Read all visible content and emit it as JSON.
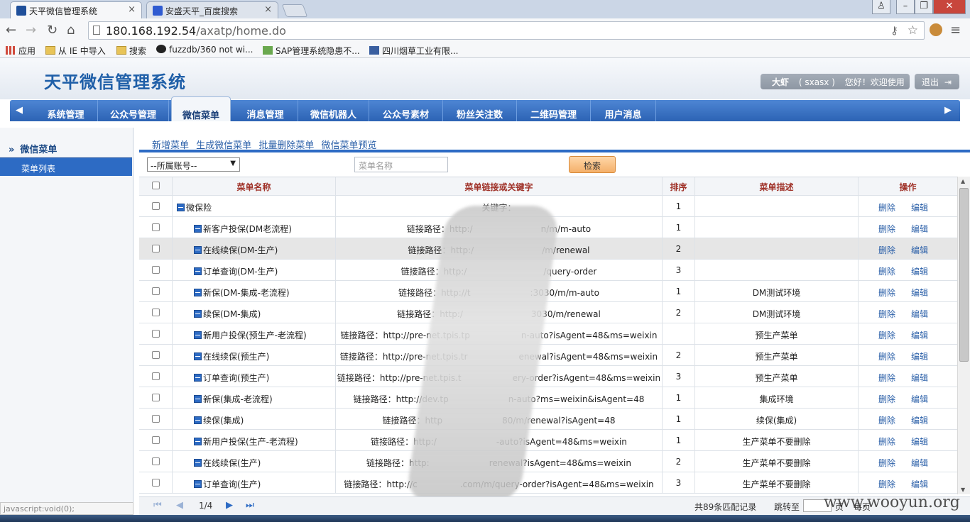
{
  "browser": {
    "tabs": [
      {
        "title": "天平微信管理系统",
        "active": true
      },
      {
        "title": "安盛天平_百度搜索",
        "active": false
      }
    ],
    "url_host": "180.168.192.54",
    "url_path": "/axatp/home.do",
    "bookmarks": [
      "应用",
      "从 IE 中导入",
      "搜索",
      "fuzzdb/360 not wi...",
      "SAP管理系统隐患不...",
      "四川烟草工业有限..."
    ],
    "status_text": "javascript:void(0);"
  },
  "app": {
    "title": "天平微信管理系统",
    "user_name": "大虾",
    "user_id": "( sxasx )",
    "welcome": "您好！欢迎使用",
    "logout": "退出"
  },
  "nav": {
    "items": [
      "系统管理",
      "公众号管理",
      "微信菜单",
      "消息管理",
      "微信机器人",
      "公众号素材",
      "粉丝关注数",
      "二维码管理",
      "用户消息"
    ],
    "active_index": 2
  },
  "sidebar": {
    "section": "微信菜单",
    "items": [
      "菜单列表"
    ]
  },
  "toolbar": {
    "add": "新增菜单",
    "generate": "生成微信菜单",
    "batch_delete": "批量删除菜单",
    "preview": "微信菜单预览"
  },
  "filters": {
    "account_select": "--所属账号--",
    "search_placeholder": "菜单名称",
    "search_button": "检索"
  },
  "table": {
    "headers": [
      "菜单名称",
      "菜单链接或关键字",
      "排序",
      "菜单描述",
      "操作"
    ],
    "delete_label": "删除",
    "edit_label": "编辑",
    "rows": [
      {
        "name": "微保险",
        "link": "关键字：",
        "order": "1",
        "desc": "",
        "level": 0
      },
      {
        "name": "新客户投保(DM老流程)",
        "link": "链接路径：http:/　　　　　　　　n/m/m-auto",
        "order": "1",
        "desc": "",
        "level": 1
      },
      {
        "name": "在线续保(DM-生产)",
        "link": "链接路径：http:/　　　　　　　　/m/renewal",
        "order": "2",
        "desc": "",
        "level": 1
      },
      {
        "name": "订单查询(DM-生产)",
        "link": "链接路径：http:/　　　　　　　　　/query-order",
        "order": "3",
        "desc": "",
        "level": 1
      },
      {
        "name": "新保(DM-集成-老流程)",
        "link": "链接路径：http://t　　　　　　　:3030/m/m-auto",
        "order": "1",
        "desc": "DM测试环境",
        "level": 1
      },
      {
        "name": "续保(DM-集成)",
        "link": "链接路径：http:/　　　　　　　　3030/m/renewal",
        "order": "2",
        "desc": "DM测试环境",
        "level": 1
      },
      {
        "name": "新用户投保(预生产-老流程)",
        "link": "链接路径：http://pre-net.tpis.tp　　　　　　n-auto?isAgent=48&ms=weixin",
        "order": "",
        "desc": "预生产菜单",
        "level": 1
      },
      {
        "name": "在线续保(预生产)",
        "link": "链接路径：http://pre-net.tpis.tr　　　　　　enewal?isAgent=48&ms=weixin",
        "order": "2",
        "desc": "预生产菜单",
        "level": 1
      },
      {
        "name": "订单查询(预生产)",
        "link": "链接路径：http://pre-net.tpis.t　　　　　　ery-order?isAgent=48&ms=weixin",
        "order": "3",
        "desc": "预生产菜单",
        "level": 1
      },
      {
        "name": "新保(集成-老流程)",
        "link": "链接路径：http://dev.tp　　　　　　　n-auto?ms=weixin&isAgent=48",
        "order": "1",
        "desc": "集成环境",
        "level": 1
      },
      {
        "name": "续保(集成)",
        "link": "链接路径：http　　　　　　　80/m/renewal?isAgent=48",
        "order": "1",
        "desc": "续保(集成)",
        "level": 1
      },
      {
        "name": "新用户投保(生产-老流程)",
        "link": "链接路径：http:/　　　　　　　-auto?isAgent=48&ms=weixin",
        "order": "1",
        "desc": "生产菜单不要删除",
        "level": 1
      },
      {
        "name": "在线续保(生产)",
        "link": "链接路径：http:　　　　　　　renewal?isAgent=48&ms=weixin",
        "order": "2",
        "desc": "生产菜单不要删除",
        "level": 1
      },
      {
        "name": "订单查询(生产)",
        "link": "链接路径：http://c　　　　　.com/m/query-order?isAgent=48&ms=weixin",
        "order": "3",
        "desc": "生产菜单不要删除",
        "level": 1
      }
    ]
  },
  "pager": {
    "page": "1/4",
    "total": "共89条匹配记录",
    "jump": "跳转至",
    "page_unit": "页",
    "per_page": "每页"
  },
  "watermark": "www.wooyun.org",
  "colors": {
    "accent": "#2d6bc4",
    "title": "#1f5fa8",
    "header_text": "#a0332a",
    "link": "#2a5fa8"
  }
}
